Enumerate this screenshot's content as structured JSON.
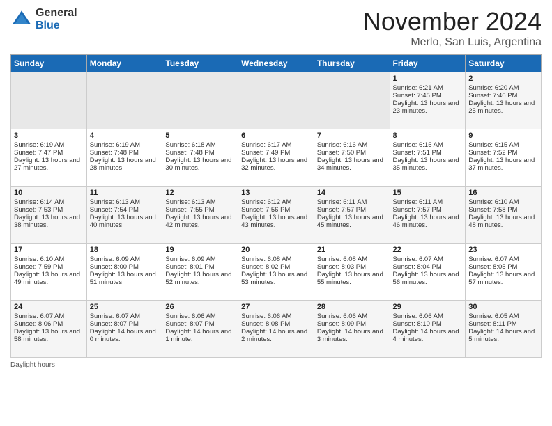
{
  "logo": {
    "general": "General",
    "blue": "Blue"
  },
  "title": "November 2024",
  "location": "Merlo, San Luis, Argentina",
  "legend": "Daylight hours",
  "days_of_week": [
    "Sunday",
    "Monday",
    "Tuesday",
    "Wednesday",
    "Thursday",
    "Friday",
    "Saturday"
  ],
  "weeks": [
    [
      {
        "day": "",
        "empty": true
      },
      {
        "day": "",
        "empty": true
      },
      {
        "day": "",
        "empty": true
      },
      {
        "day": "",
        "empty": true
      },
      {
        "day": "",
        "empty": true
      },
      {
        "day": "1",
        "sunrise": "Sunrise: 6:21 AM",
        "sunset": "Sunset: 7:45 PM",
        "daylight": "Daylight: 13 hours and 23 minutes."
      },
      {
        "day": "2",
        "sunrise": "Sunrise: 6:20 AM",
        "sunset": "Sunset: 7:46 PM",
        "daylight": "Daylight: 13 hours and 25 minutes."
      }
    ],
    [
      {
        "day": "3",
        "sunrise": "Sunrise: 6:19 AM",
        "sunset": "Sunset: 7:47 PM",
        "daylight": "Daylight: 13 hours and 27 minutes."
      },
      {
        "day": "4",
        "sunrise": "Sunrise: 6:19 AM",
        "sunset": "Sunset: 7:48 PM",
        "daylight": "Daylight: 13 hours and 28 minutes."
      },
      {
        "day": "5",
        "sunrise": "Sunrise: 6:18 AM",
        "sunset": "Sunset: 7:48 PM",
        "daylight": "Daylight: 13 hours and 30 minutes."
      },
      {
        "day": "6",
        "sunrise": "Sunrise: 6:17 AM",
        "sunset": "Sunset: 7:49 PM",
        "daylight": "Daylight: 13 hours and 32 minutes."
      },
      {
        "day": "7",
        "sunrise": "Sunrise: 6:16 AM",
        "sunset": "Sunset: 7:50 PM",
        "daylight": "Daylight: 13 hours and 34 minutes."
      },
      {
        "day": "8",
        "sunrise": "Sunrise: 6:15 AM",
        "sunset": "Sunset: 7:51 PM",
        "daylight": "Daylight: 13 hours and 35 minutes."
      },
      {
        "day": "9",
        "sunrise": "Sunrise: 6:15 AM",
        "sunset": "Sunset: 7:52 PM",
        "daylight": "Daylight: 13 hours and 37 minutes."
      }
    ],
    [
      {
        "day": "10",
        "sunrise": "Sunrise: 6:14 AM",
        "sunset": "Sunset: 7:53 PM",
        "daylight": "Daylight: 13 hours and 38 minutes."
      },
      {
        "day": "11",
        "sunrise": "Sunrise: 6:13 AM",
        "sunset": "Sunset: 7:54 PM",
        "daylight": "Daylight: 13 hours and 40 minutes."
      },
      {
        "day": "12",
        "sunrise": "Sunrise: 6:13 AM",
        "sunset": "Sunset: 7:55 PM",
        "daylight": "Daylight: 13 hours and 42 minutes."
      },
      {
        "day": "13",
        "sunrise": "Sunrise: 6:12 AM",
        "sunset": "Sunset: 7:56 PM",
        "daylight": "Daylight: 13 hours and 43 minutes."
      },
      {
        "day": "14",
        "sunrise": "Sunrise: 6:11 AM",
        "sunset": "Sunset: 7:57 PM",
        "daylight": "Daylight: 13 hours and 45 minutes."
      },
      {
        "day": "15",
        "sunrise": "Sunrise: 6:11 AM",
        "sunset": "Sunset: 7:57 PM",
        "daylight": "Daylight: 13 hours and 46 minutes."
      },
      {
        "day": "16",
        "sunrise": "Sunrise: 6:10 AM",
        "sunset": "Sunset: 7:58 PM",
        "daylight": "Daylight: 13 hours and 48 minutes."
      }
    ],
    [
      {
        "day": "17",
        "sunrise": "Sunrise: 6:10 AM",
        "sunset": "Sunset: 7:59 PM",
        "daylight": "Daylight: 13 hours and 49 minutes."
      },
      {
        "day": "18",
        "sunrise": "Sunrise: 6:09 AM",
        "sunset": "Sunset: 8:00 PM",
        "daylight": "Daylight: 13 hours and 51 minutes."
      },
      {
        "day": "19",
        "sunrise": "Sunrise: 6:09 AM",
        "sunset": "Sunset: 8:01 PM",
        "daylight": "Daylight: 13 hours and 52 minutes."
      },
      {
        "day": "20",
        "sunrise": "Sunrise: 6:08 AM",
        "sunset": "Sunset: 8:02 PM",
        "daylight": "Daylight: 13 hours and 53 minutes."
      },
      {
        "day": "21",
        "sunrise": "Sunrise: 6:08 AM",
        "sunset": "Sunset: 8:03 PM",
        "daylight": "Daylight: 13 hours and 55 minutes."
      },
      {
        "day": "22",
        "sunrise": "Sunrise: 6:07 AM",
        "sunset": "Sunset: 8:04 PM",
        "daylight": "Daylight: 13 hours and 56 minutes."
      },
      {
        "day": "23",
        "sunrise": "Sunrise: 6:07 AM",
        "sunset": "Sunset: 8:05 PM",
        "daylight": "Daylight: 13 hours and 57 minutes."
      }
    ],
    [
      {
        "day": "24",
        "sunrise": "Sunrise: 6:07 AM",
        "sunset": "Sunset: 8:06 PM",
        "daylight": "Daylight: 13 hours and 58 minutes."
      },
      {
        "day": "25",
        "sunrise": "Sunrise: 6:07 AM",
        "sunset": "Sunset: 8:07 PM",
        "daylight": "Daylight: 14 hours and 0 minutes."
      },
      {
        "day": "26",
        "sunrise": "Sunrise: 6:06 AM",
        "sunset": "Sunset: 8:07 PM",
        "daylight": "Daylight: 14 hours and 1 minute."
      },
      {
        "day": "27",
        "sunrise": "Sunrise: 6:06 AM",
        "sunset": "Sunset: 8:08 PM",
        "daylight": "Daylight: 14 hours and 2 minutes."
      },
      {
        "day": "28",
        "sunrise": "Sunrise: 6:06 AM",
        "sunset": "Sunset: 8:09 PM",
        "daylight": "Daylight: 14 hours and 3 minutes."
      },
      {
        "day": "29",
        "sunrise": "Sunrise: 6:06 AM",
        "sunset": "Sunset: 8:10 PM",
        "daylight": "Daylight: 14 hours and 4 minutes."
      },
      {
        "day": "30",
        "sunrise": "Sunrise: 6:05 AM",
        "sunset": "Sunset: 8:11 PM",
        "daylight": "Daylight: 14 hours and 5 minutes."
      }
    ]
  ]
}
